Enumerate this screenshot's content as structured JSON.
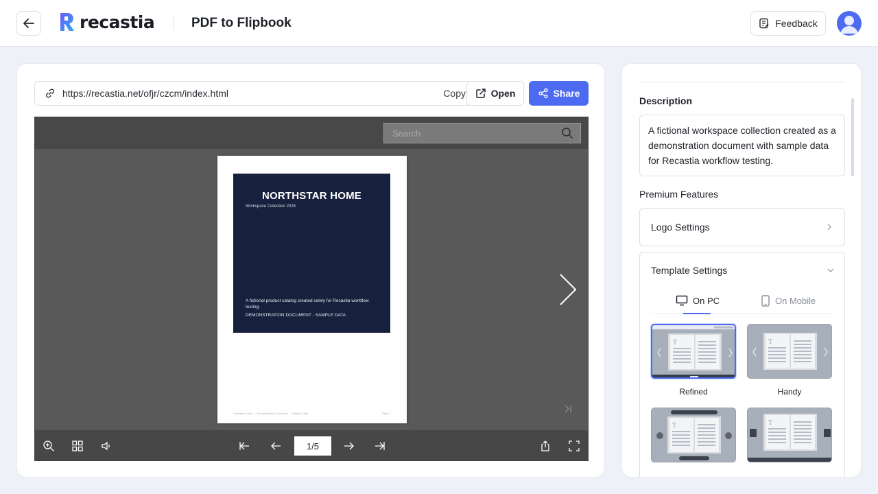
{
  "header": {
    "logo_text": "recastia",
    "title": "PDF to Flipbook",
    "feedback_label": "Feedback"
  },
  "toolbar": {
    "url": "https://recastia.net/ofjr/czcm/index.html",
    "copy_label": "Copy",
    "open_label": "Open",
    "share_label": "Share"
  },
  "viewer": {
    "search_placeholder": "Search",
    "page_indicator": "1/5",
    "cover": {
      "title": "NORTHSTAR HOME",
      "subtitle": "Workspace Collection 2026",
      "description": "A fictional product catalog created solely for Recastia workflow testing.",
      "demo_note": "DEMONSTRATION DOCUMENT - SAMPLE DATA"
    },
    "footer_left": "Northstar Home — Demonstration Document — Sample Data",
    "footer_right": "Page 1"
  },
  "sidebar": {
    "description_label": "Description",
    "description_text": "A fictional workspace collection created as a demonstration document with sample data for Recastia workflow testing.",
    "premium_label": "Premium Features",
    "logo_settings_label": "Logo Settings",
    "template_settings_label": "Template Settings",
    "tabs": [
      {
        "label": "On PC",
        "active": true
      },
      {
        "label": "On Mobile",
        "active": false
      }
    ],
    "templates": [
      {
        "label": "Refined",
        "selected": true
      },
      {
        "label": "Handy",
        "selected": false
      },
      {
        "label": "",
        "selected": false
      },
      {
        "label": "",
        "selected": false
      }
    ]
  },
  "colors": {
    "accent": "#4d6bf0",
    "cover_bg": "#17213d",
    "viewer_bg": "#595959"
  }
}
